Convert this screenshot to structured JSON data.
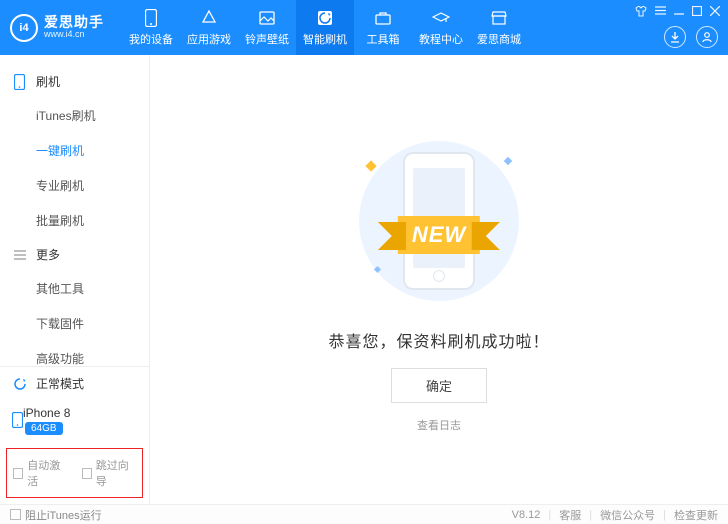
{
  "brand": {
    "name": "爱思助手",
    "badge": "i4",
    "url": "www.i4.cn"
  },
  "nav": [
    {
      "label": "我的设备"
    },
    {
      "label": "应用游戏"
    },
    {
      "label": "铃声壁纸"
    },
    {
      "label": "智能刷机"
    },
    {
      "label": "工具箱"
    },
    {
      "label": "教程中心"
    },
    {
      "label": "爱思商城"
    }
  ],
  "sidebar": {
    "sections": [
      {
        "title": "刷机",
        "items": [
          "iTunes刷机",
          "一键刷机",
          "专业刷机",
          "批量刷机"
        ]
      },
      {
        "title": "更多",
        "items": [
          "其他工具",
          "下载固件",
          "高级功能"
        ]
      }
    ],
    "mode": "正常模式",
    "device": {
      "name": "iPhone 8",
      "storage": "64GB"
    },
    "checks": {
      "auto_activate": "自动激活",
      "skip_guide": "跳过向导"
    }
  },
  "main": {
    "ribbon": "NEW",
    "message": "恭喜您，保资料刷机成功啦！",
    "ok": "确定",
    "log": "查看日志"
  },
  "footer": {
    "block_itunes": "阻止iTunes运行",
    "version": "V8.12",
    "links": [
      "客服",
      "微信公众号",
      "检查更新"
    ]
  }
}
